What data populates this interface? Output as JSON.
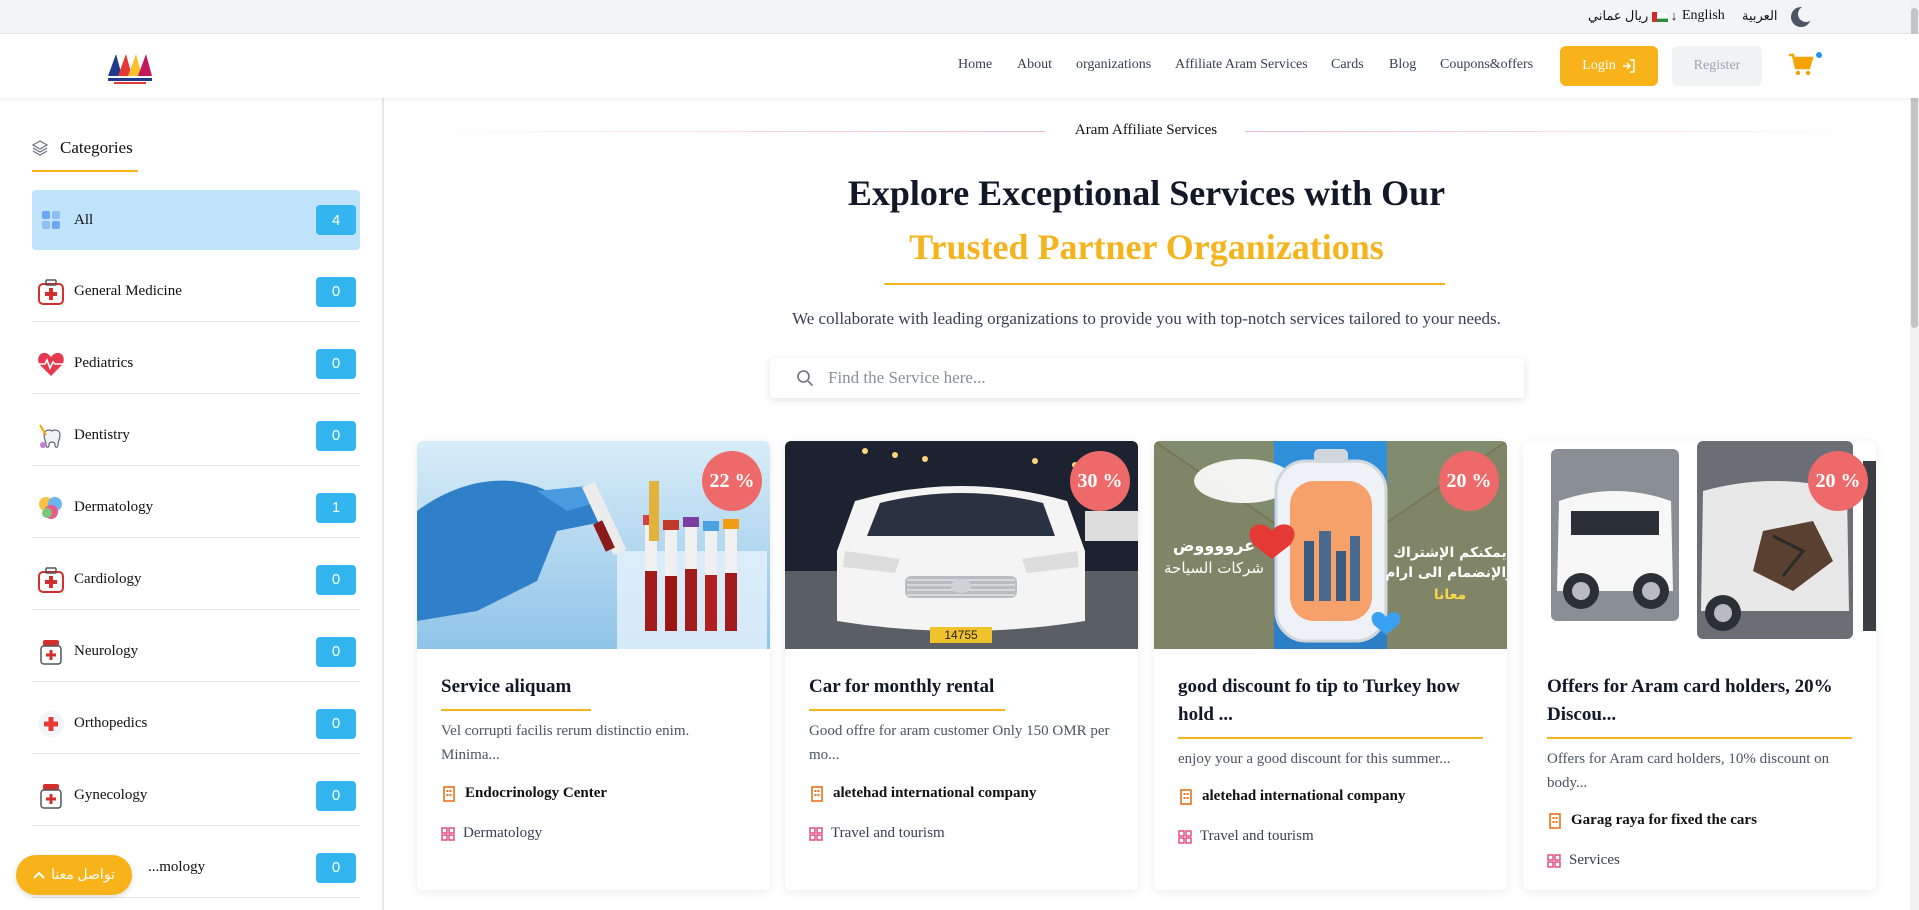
{
  "topbar": {
    "lang_ar": "العربية",
    "lang_en": "English",
    "currency": "ريال عماني"
  },
  "nav": {
    "items": [
      "Home",
      "About",
      "organizations",
      "Affiliate Aram Services",
      "Cards",
      "Blog",
      "Coupons&offers"
    ],
    "login": "Login",
    "register": "Register"
  },
  "sidebar": {
    "title": "Categories",
    "items": [
      {
        "label": "All",
        "count": "4"
      },
      {
        "label": "General Medicine",
        "count": "0"
      },
      {
        "label": "Pediatrics",
        "count": "0"
      },
      {
        "label": "Dentistry",
        "count": "0"
      },
      {
        "label": "Dermatology",
        "count": "1"
      },
      {
        "label": "Cardiology",
        "count": "0"
      },
      {
        "label": "Neurology",
        "count": "0"
      },
      {
        "label": "Orthopedics",
        "count": "0"
      },
      {
        "label": "Gynecology",
        "count": "0"
      },
      {
        "label": "...mology",
        "count": "0"
      }
    ],
    "contact": "تواصل معنا"
  },
  "main": {
    "section_label": "Aram Affiliate Services",
    "title_line1": "Explore Exceptional Services with Our",
    "title_line2": "Trusted Partner Organizations",
    "subtitle": "We collaborate with leading organizations to provide you with top-notch services tailored to your needs.",
    "search_placeholder": "Find the Service here...",
    "cards": [
      {
        "discount": "22 %",
        "title": "Service aliquam",
        "desc": "Vel corrupti facilis rerum distinctio enim. Minima...",
        "org": "Endocrinology Center",
        "category": "Dermatology"
      },
      {
        "discount": "30 %",
        "title": "Car for monthly rental",
        "desc": "Good offre for aram customer Only 150 OMR per mo...",
        "org": "aletehad international company",
        "category": "Travel and tourism",
        "plate": "14755"
      },
      {
        "discount": "20 %",
        "title": "good discount fo tip to Turkey how hold ...",
        "desc": "enjoy your a good discount for this summer...",
        "org": "aletehad international company",
        "category": "Travel and tourism",
        "promo_ar_1": "عرووووض",
        "promo_ar_2": "شركات السياحة",
        "promo_ar_3": "يمكنكم الإشتراك",
        "promo_ar_4": "والإنضمام الى ارام",
        "promo_ar_5": "معانا"
      },
      {
        "discount": "20 %",
        "title": "Offers for Aram card holders, 20% Discou...",
        "desc": "Offers for Aram card holders, 10% discount on body...",
        "org": "Garag raya for fixed the cars",
        "category": "Services"
      }
    ]
  },
  "colors": {
    "accent": "#f9b31a",
    "badge": "#ee6a6a",
    "count": "#33b5f0",
    "active": "#bfe3fb"
  }
}
